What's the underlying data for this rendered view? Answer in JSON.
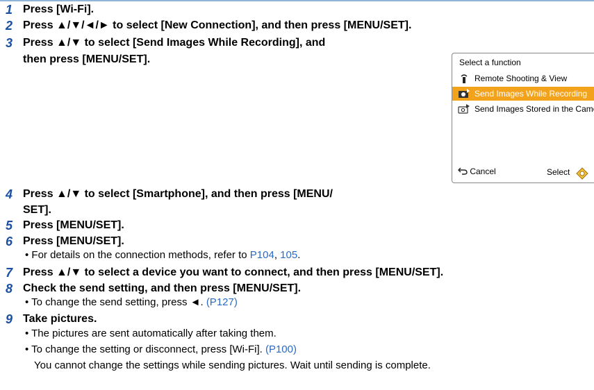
{
  "steps": [
    {
      "num": "1",
      "text": "Press [Wi-Fi]."
    },
    {
      "num": "2",
      "text": "Press ▲/▼/◄/► to select [New Connection], and then press [MENU/SET]."
    },
    {
      "num": "3",
      "line1": "Press ▲/▼ to select [Send Images While Recording], and",
      "line2": "then press [MENU/SET]."
    },
    {
      "num": "4",
      "line1": "Press ▲/▼ to select [Smartphone], and then press [MENU/",
      "line2": "SET]."
    },
    {
      "num": "5",
      "text": "Press [MENU/SET]."
    },
    {
      "num": "6",
      "text": "Press [MENU/SET].",
      "bullet": {
        "text": "• For details on the connection methods, refer to ",
        "link1": "P104",
        "sep": ", ",
        "link2": "105",
        "end": "."
      }
    },
    {
      "num": "7",
      "text": "Press ▲/▼ to select a device you want to connect, and then press [MENU/SET]."
    },
    {
      "num": "8",
      "text": "Check the send setting, and then press [MENU/SET].",
      "bullet": {
        "text": "• To change the send setting, press ◄. ",
        "link": "(P127)"
      }
    },
    {
      "num": "9",
      "text": "Take pictures.",
      "bullet1": "• The pictures are sent automatically after taking them.",
      "bullet2": {
        "text": "• To change the setting or disconnect, press [Wi-Fi]. ",
        "link": "(P100)"
      },
      "note": "You cannot change the settings while sending pictures. Wait until sending is complete."
    }
  ],
  "camera_screen": {
    "title": "Select a function",
    "items": [
      {
        "label": "Remote Shooting & View",
        "icon": "remote-icon",
        "selected": false
      },
      {
        "label": "Send Images While Recording",
        "icon": "camera-send-icon",
        "selected": true
      },
      {
        "label": "Send Images Stored in the Camera",
        "icon": "stored-images-icon",
        "selected": false
      }
    ],
    "cancel_label": "Cancel",
    "select_label": "Select",
    "highlight_color": "#f3a21c"
  },
  "colors": {
    "step_number": "#1a4fa3",
    "link": "#2a6ac2",
    "rule": "#8fb4d9"
  }
}
